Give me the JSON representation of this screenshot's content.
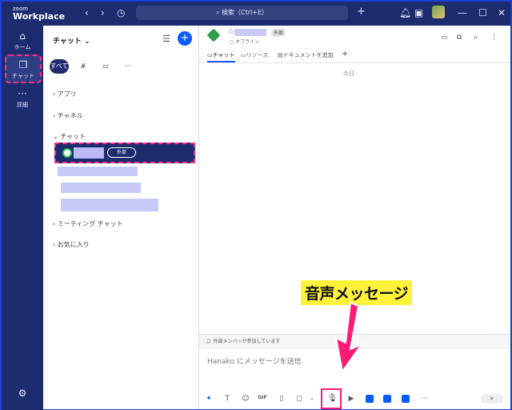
{
  "titlebar": {
    "logo_small": "zoom",
    "logo_big": "Workplace",
    "search_placeholder": "検索（Ctrl+E）"
  },
  "rail": {
    "items": [
      {
        "label": "ホーム"
      },
      {
        "label": "チャット"
      },
      {
        "label": "詳細"
      }
    ]
  },
  "panel": {
    "title": "チャット",
    "filters": [
      "すべて",
      "#",
      "",
      "···"
    ],
    "sections": {
      "apps": "アプリ",
      "channels": "チャネル",
      "chats": "チャット",
      "meeting_chats": "ミーティング チャット",
      "favorites": "お気に入り"
    },
    "selected_badge": "外部"
  },
  "main": {
    "badge": "外部",
    "status": "オフライン",
    "tabs": [
      "チャット",
      "リソース",
      "ドキュメントを追加"
    ],
    "date_label": "今日",
    "notice": "外部メンバーが参加しています",
    "input_placeholder": "Hanako にメッセージを送信",
    "gif_label": "GIF"
  },
  "callout": {
    "text": "音声メッセージ"
  },
  "colors": {
    "rail_bg": "#1d2b6f",
    "accent": "#0b5cff",
    "highlight": "#ff2d86",
    "callout_bg": "#fff23a"
  }
}
